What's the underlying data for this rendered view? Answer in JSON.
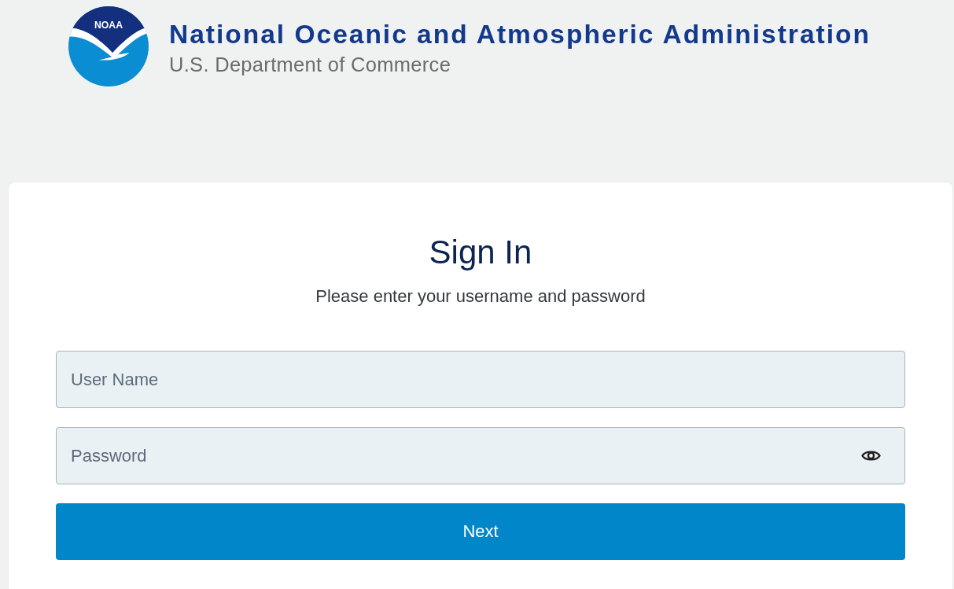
{
  "header": {
    "logo": {
      "text": "NOAA"
    },
    "title": "National Oceanic and Atmospheric Administration",
    "subtitle": "U.S. Department of Commerce"
  },
  "sign_in": {
    "title": "Sign In",
    "subtitle": "Please enter your username and password",
    "fields": [
      {
        "kind": "text",
        "placeholder": "User Name"
      },
      {
        "kind": "password",
        "placeholder": "Password"
      }
    ],
    "button": "Next"
  }
}
